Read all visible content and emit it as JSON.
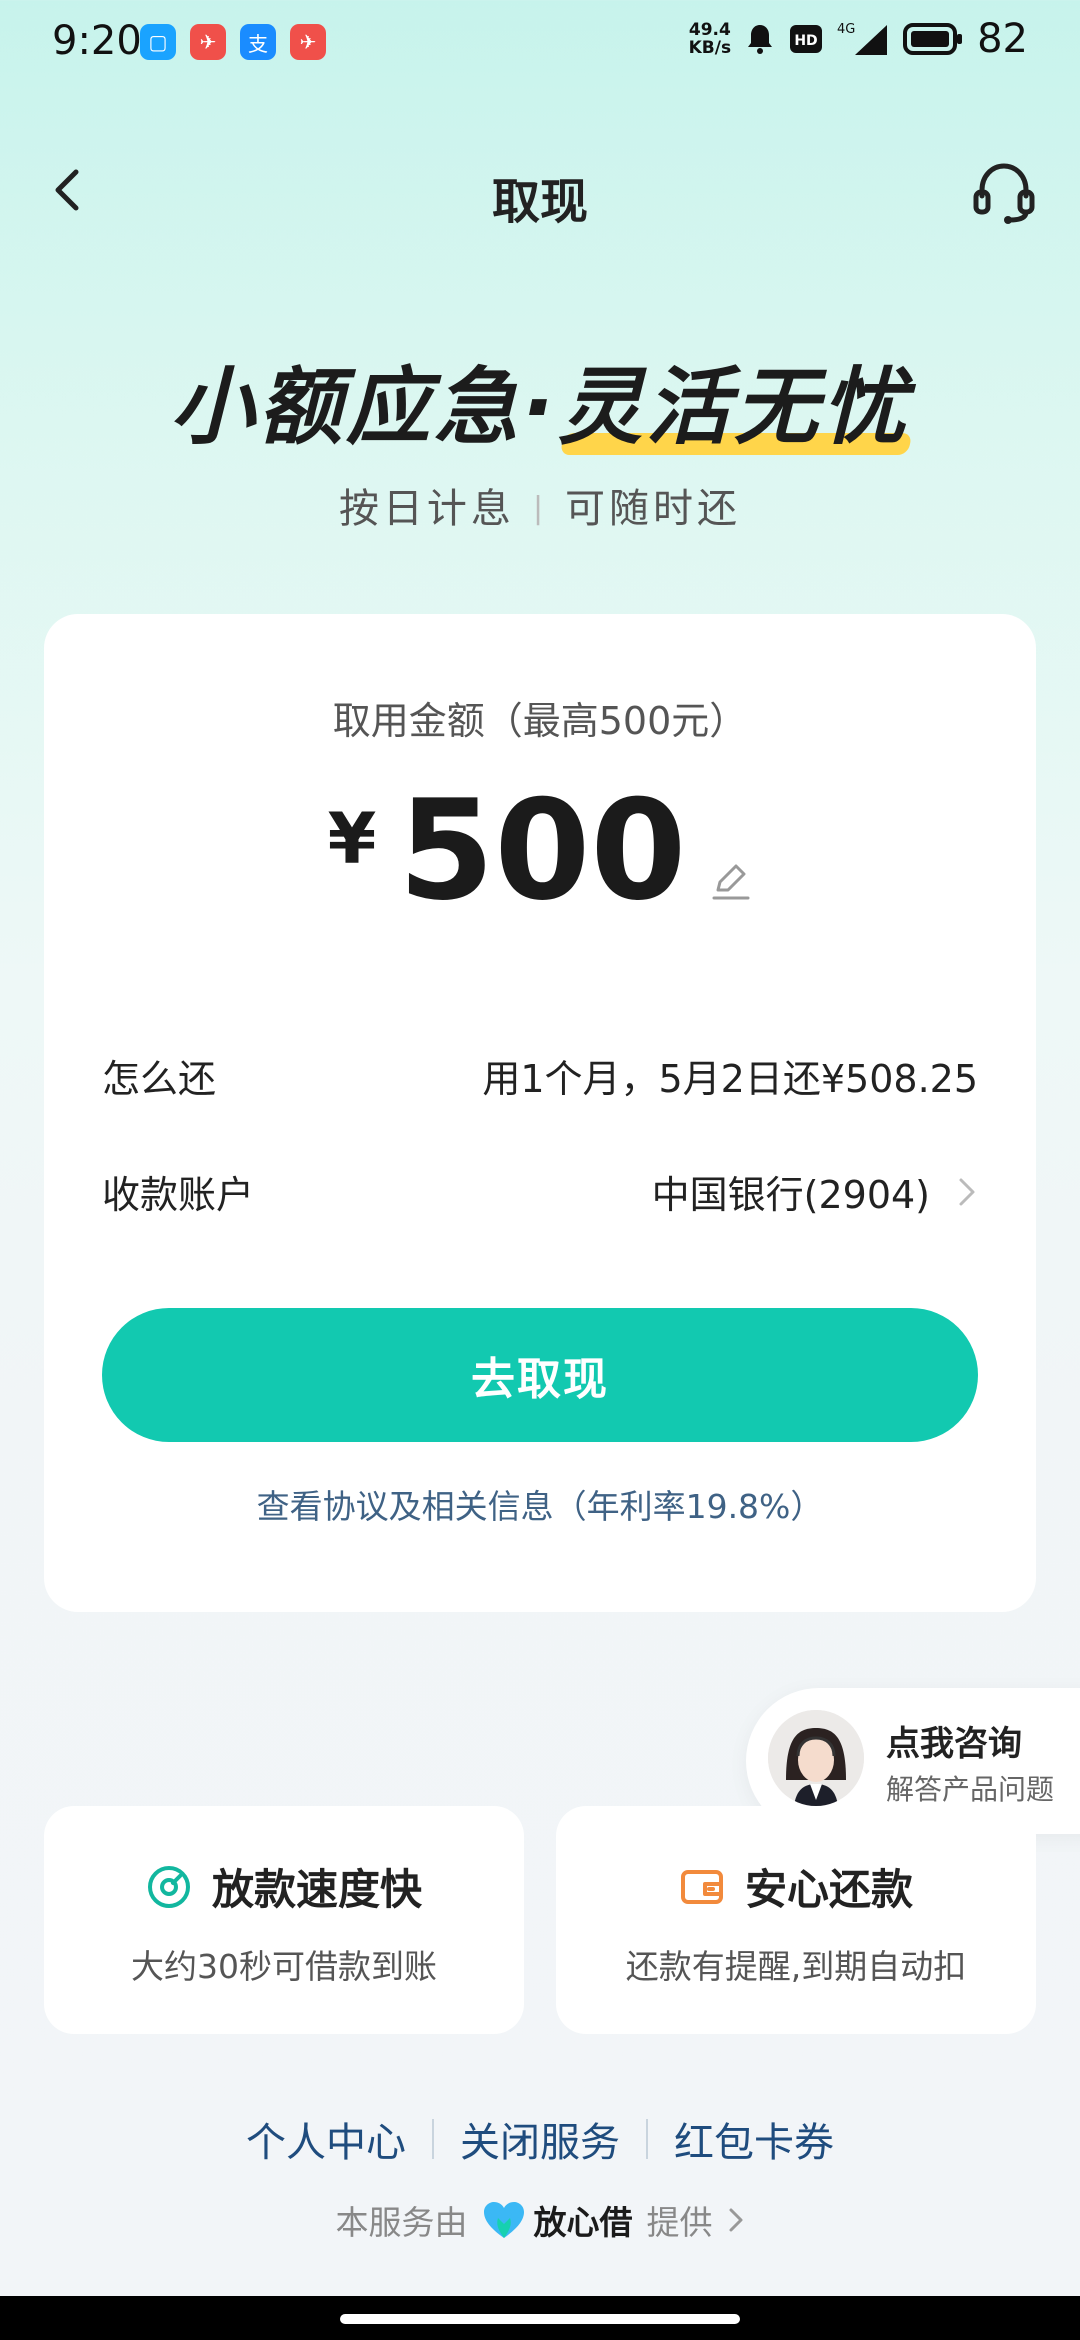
{
  "status": {
    "time": "9:20",
    "speed_top": "49.4",
    "speed_bottom": "KB/s",
    "hd": "HD",
    "network": "4G",
    "battery": "82"
  },
  "header": {
    "title": "取现"
  },
  "slogan": {
    "part1": "小额应急·",
    "part2": "灵活无忧",
    "sub_left": "按日计息",
    "sub_sep": "|",
    "sub_right": "可随时还"
  },
  "card": {
    "amount_label": "取用金额（最高500元）",
    "currency": "¥",
    "amount": "500",
    "repay_label": "怎么还",
    "repay_value": "用1个月，5月2日还¥508.25",
    "account_label": "收款账户",
    "account_value": "中国银行(2904)",
    "cta": "去取现",
    "agreement": "查看协议及相关信息（年利率19.8%）"
  },
  "consult": {
    "title": "点我咨询",
    "subtitle": "解答产品问题"
  },
  "features": [
    {
      "title": "放款速度快",
      "desc": "大约30秒可借款到账",
      "icon": "speed-gauge-icon",
      "color": "#12b79f"
    },
    {
      "title": "安心还款",
      "desc": "还款有提醒,到期自动扣",
      "icon": "wallet-icon",
      "color": "#f28a3c"
    }
  ],
  "footer": {
    "links": [
      "个人中心",
      "关闭服务",
      "红包卡券"
    ],
    "provider_prefix": "本服务由",
    "provider_name": "放心借",
    "provider_suffix": "提供"
  },
  "colors": {
    "accent": "#12c9b0",
    "link": "#1f4c7e",
    "highlight": "#ffd54a"
  }
}
